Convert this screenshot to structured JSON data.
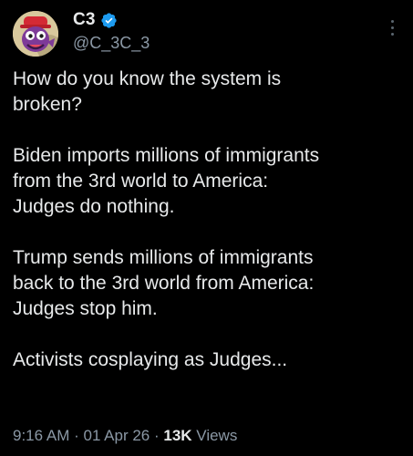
{
  "author": {
    "display_name": "C3",
    "handle": "@C_3C_3",
    "verified_icon": "verified-badge-icon",
    "avatar_icon": "cartoon-avatar"
  },
  "colors": {
    "background": "#000000",
    "text": "#e7e9ea",
    "secondary": "#8b98a5",
    "verified": "#1d9bf0"
  },
  "tweet": {
    "paragraphs": [
      "How do you know the system is\nbroken?",
      "Biden imports millions of immigrants\nfrom the 3rd world to America:\nJudges do nothing.",
      "Trump sends millions of immigrants\nback to the 3rd world from America:\nJudges stop him.",
      "Activists cosplaying as Judges..."
    ]
  },
  "meta": {
    "time": "9:16 AM",
    "separator": " · ",
    "date": "01 Apr 26",
    "views_count": "13K",
    "views_label": " Views"
  }
}
